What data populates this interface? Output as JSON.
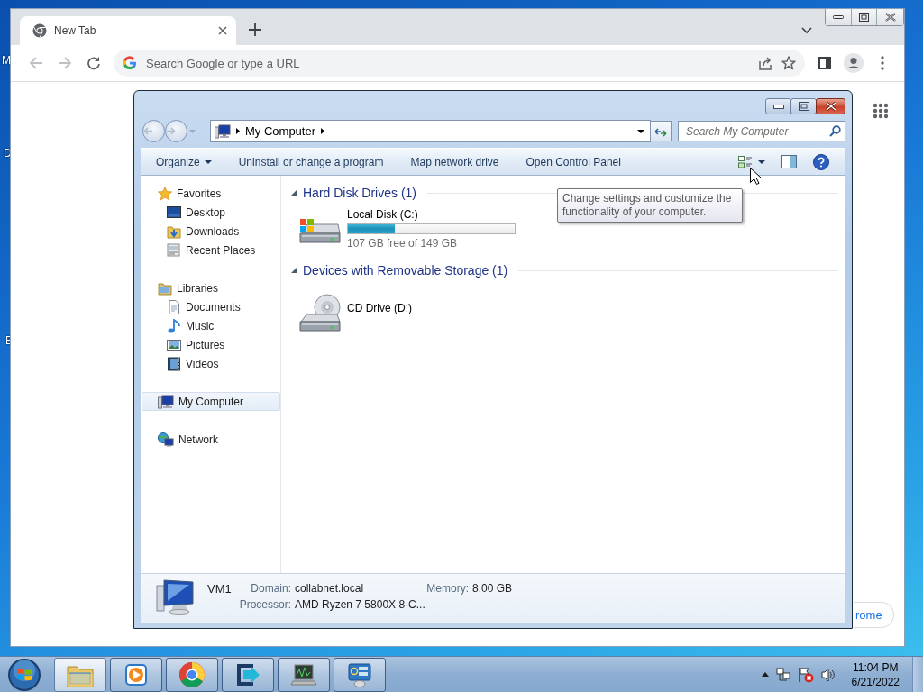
{
  "desktop": {
    "icon_labels": [
      "M",
      "D",
      "E"
    ]
  },
  "browser": {
    "tabs": [
      {
        "title": "New Tab",
        "selected": true
      }
    ],
    "omnibox": {
      "placeholder": "Search Google or type a URL"
    },
    "customize_button": {
      "label": "rome"
    }
  },
  "explorer": {
    "address": {
      "crumbs": [
        "My Computer"
      ]
    },
    "search": {
      "placeholder": "Search My Computer"
    },
    "commands": [
      {
        "label": "Organize",
        "kind": "menu"
      },
      {
        "label": "Uninstall or change a program",
        "kind": "plain"
      },
      {
        "label": "Map network drive",
        "kind": "plain"
      },
      {
        "label": "Open Control Panel",
        "kind": "plain"
      }
    ],
    "nav": [
      {
        "label": "Favorites",
        "kind": "star",
        "selected": false,
        "children": [
          {
            "label": "Desktop",
            "kind": "desktop",
            "selected": false
          },
          {
            "label": "Downloads",
            "kind": "downloads",
            "selected": false
          },
          {
            "label": "Recent Places",
            "kind": "recent",
            "selected": false
          }
        ]
      },
      {
        "label": "Libraries",
        "kind": "libraries",
        "selected": false,
        "children": [
          {
            "label": "Documents",
            "kind": "documents",
            "selected": false
          },
          {
            "label": "Music",
            "kind": "music",
            "selected": false
          },
          {
            "label": "Pictures",
            "kind": "pictures",
            "selected": false
          },
          {
            "label": "Videos",
            "kind": "videos",
            "selected": false
          }
        ]
      },
      {
        "label": "My Computer",
        "kind": "computer",
        "selected": true
      },
      {
        "label": "Network",
        "kind": "network",
        "selected": false
      }
    ],
    "groups": [
      {
        "title": "Hard Disk Drives (1)",
        "expanded": true,
        "items": [
          {
            "name": "Local Disk (C:)",
            "kind": "disk",
            "level": 0.28,
            "free": "107 GB free of 149 GB"
          }
        ]
      },
      {
        "title": "Devices with Removable Storage (1)",
        "expanded": true,
        "items": [
          {
            "name": "CD Drive (D:)",
            "kind": "cd"
          }
        ]
      }
    ],
    "tooltip": "Change settings and customize the functionality of your computer.",
    "details": {
      "name": "VM1",
      "fields": [
        {
          "label": "Domain:",
          "value": "collabnet.local"
        },
        {
          "label": "Memory:",
          "value": "8.00 GB"
        },
        {
          "label": "Processor:",
          "value": "AMD Ryzen 7 5800X 8-C..."
        }
      ]
    }
  },
  "taskbar": {
    "apps": [
      {
        "kind": "folder",
        "active": true
      },
      {
        "kind": "media",
        "active": false
      },
      {
        "kind": "chrome",
        "active": false
      },
      {
        "kind": "transfer",
        "active": false
      },
      {
        "kind": "monitor",
        "active": false
      },
      {
        "kind": "panel",
        "active": false
      }
    ],
    "time": "11:04 PM",
    "date": "6/21/2022"
  }
}
